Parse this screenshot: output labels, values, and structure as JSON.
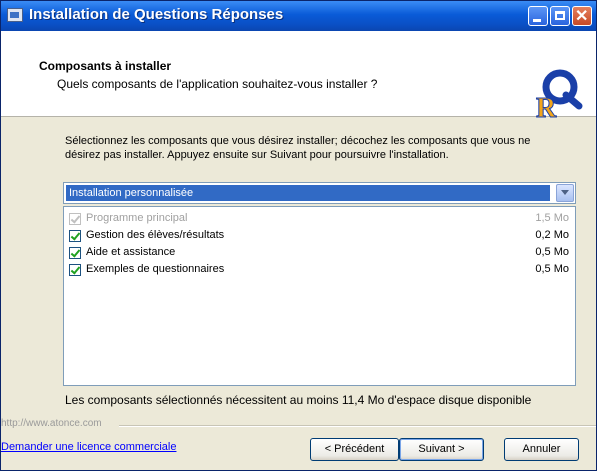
{
  "window": {
    "title": "Installation de Questions Réponses"
  },
  "titlebar_buttons": {
    "minimize_icon": "minimize-icon",
    "maximize_icon": "maximize-icon",
    "close_icon": "close-icon"
  },
  "header": {
    "title": "Composants à installer",
    "subtitle": "Quels composants de l'application souhaitez-vous installer ?",
    "logo_letters": "QR"
  },
  "description": "Sélectionnez les composants que vous désirez installer; décochez les composants que vous ne désirez pas installer. Appuyez ensuite sur Suivant pour poursuivre l'installation.",
  "install_type": {
    "selected": "Installation personnalisée"
  },
  "components": [
    {
      "label": "Programme principal",
      "size": "1,5 Mo",
      "checked": true,
      "disabled": true
    },
    {
      "label": "Gestion des élèves/résultats",
      "size": "0,2 Mo",
      "checked": true,
      "disabled": false
    },
    {
      "label": "Aide et assistance",
      "size": "0,5 Mo",
      "checked": true,
      "disabled": false
    },
    {
      "label": "Exemples de questionnaires",
      "size": "0,5 Mo",
      "checked": true,
      "disabled": false
    }
  ],
  "disk_space_text": "Les composants sélectionnés nécessitent au moins 11,4 Mo d'espace disque disponible",
  "brand_url": "http://www.atonce.com",
  "footer": {
    "license_link": "Demander une licence commerciale",
    "prev_button": "< Précédent",
    "next_button": "Suivant >",
    "cancel_button": "Annuler"
  },
  "colors": {
    "titlebar": "#0a5bd8",
    "selection": "#316ac5",
    "logo_q": "#1a3fa8",
    "logo_r": "#f2a51a"
  }
}
